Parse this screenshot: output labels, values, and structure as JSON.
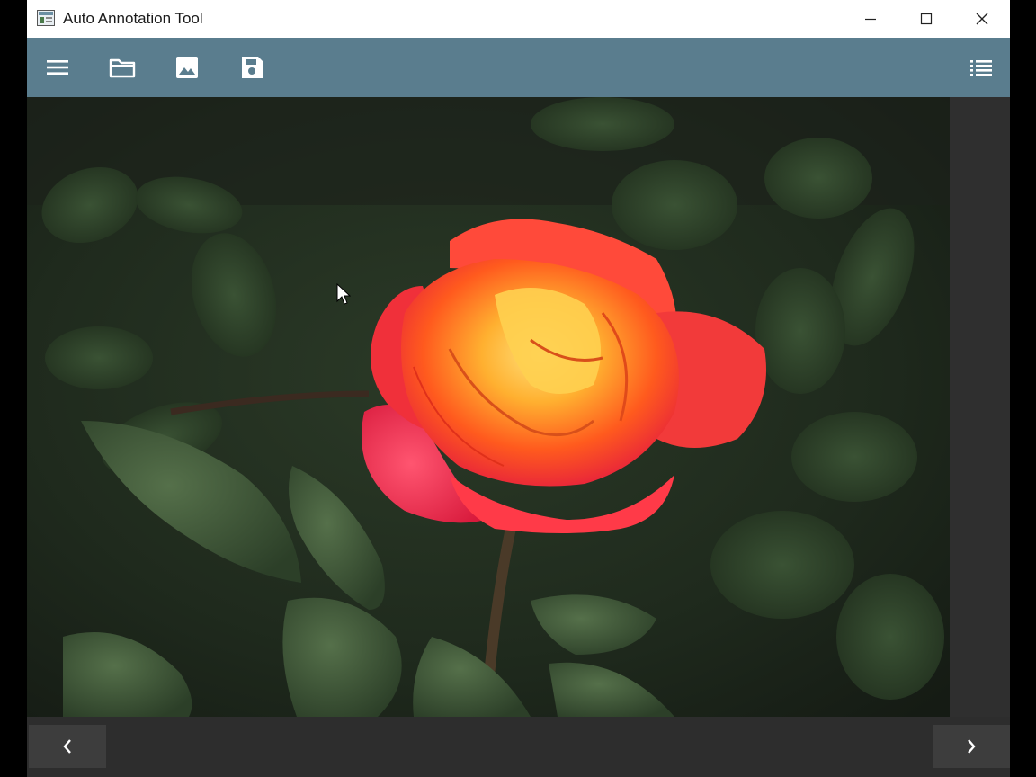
{
  "window": {
    "title": "Auto Annotation Tool",
    "controls": [
      "minimize",
      "maximize",
      "close"
    ]
  },
  "toolbar": {
    "left_icons": [
      "menu-icon",
      "folder-open-icon",
      "image-icon",
      "save-icon"
    ],
    "right_icons": [
      "list-icon"
    ],
    "background": "#5a7d8e"
  },
  "canvas": {
    "content": "photo of an orange-red rose among dark green leaves"
  },
  "navigation": {
    "prev_icon": "chevron-left-icon",
    "next_icon": "chevron-right-icon"
  },
  "colors": {
    "titlebar": "#ffffff",
    "toolbar": "#5a7d8e",
    "panel": "#2f2f2f",
    "nav_button": "#3d3d3d"
  }
}
